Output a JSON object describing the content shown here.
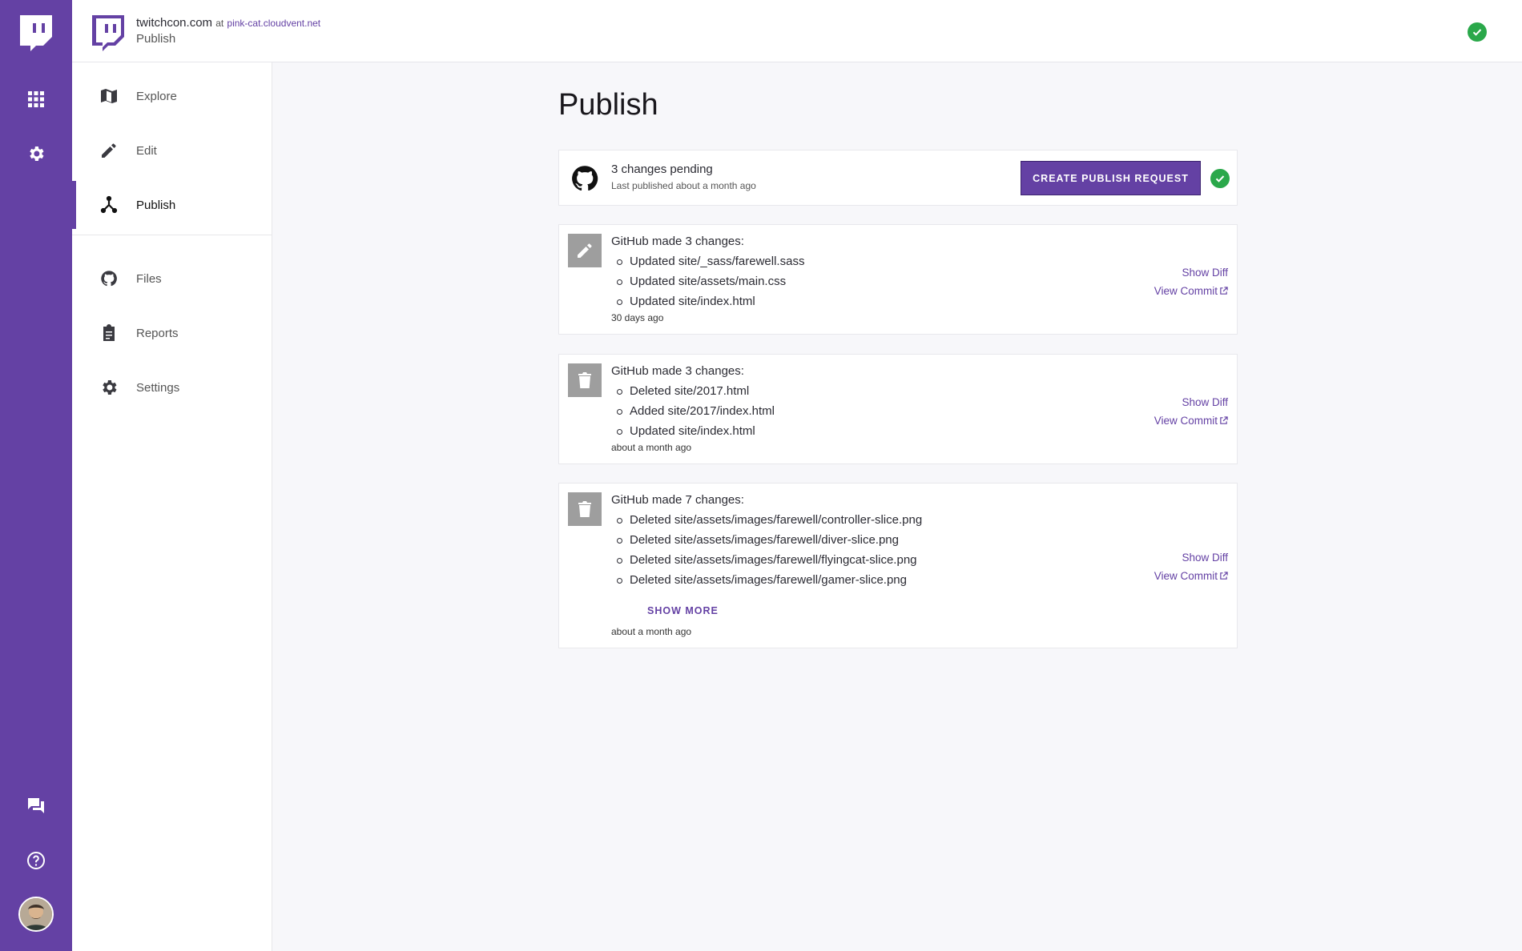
{
  "header": {
    "site_name": "twitchcon.com",
    "at_label": "at",
    "host": "pink-cat.cloudvent.net",
    "section": "Publish"
  },
  "rail": {
    "icons": [
      "apps-grid-icon",
      "gear-icon",
      "chat-icon",
      "help-icon"
    ]
  },
  "nav": {
    "items": [
      {
        "label": "Explore",
        "icon": "map-icon"
      },
      {
        "label": "Edit",
        "icon": "pencil-icon"
      },
      {
        "label": "Publish",
        "icon": "publish-icon",
        "active": true
      },
      {
        "label": "Files",
        "icon": "github-icon"
      },
      {
        "label": "Reports",
        "icon": "clipboard-icon"
      },
      {
        "label": "Settings",
        "icon": "gear-icon"
      }
    ]
  },
  "main": {
    "title": "Publish",
    "pending": {
      "summary": "3 changes pending",
      "last_published": "Last published about a month ago",
      "button_label": "CREATE PUBLISH REQUEST"
    },
    "changes": [
      {
        "icon": "pencil-icon",
        "heading": "GitHub made 3 changes:",
        "files": [
          "Updated site/_sass/farewell.sass",
          "Updated site/assets/main.css",
          "Updated site/index.html"
        ],
        "time": "30 days ago",
        "show_diff": "Show Diff",
        "view_commit": "View Commit"
      },
      {
        "icon": "trash-icon",
        "heading": "GitHub made 3 changes:",
        "files": [
          "Deleted site/2017.html",
          "Added site/2017/index.html",
          "Updated site/index.html"
        ],
        "time": "about a month ago",
        "show_diff": "Show Diff",
        "view_commit": "View Commit"
      },
      {
        "icon": "trash-icon",
        "heading": "GitHub made 7 changes:",
        "files": [
          "Deleted site/assets/images/farewell/controller-slice.png",
          "Deleted site/assets/images/farewell/diver-slice.png",
          "Deleted site/assets/images/farewell/flyingcat-slice.png",
          "Deleted site/assets/images/farewell/gamer-slice.png"
        ],
        "show_more": "SHOW MORE",
        "time": "about a month ago",
        "show_diff": "Show Diff",
        "view_commit": "View Commit"
      }
    ]
  },
  "colors": {
    "brand": "#6441a4",
    "success": "#2aa84a",
    "badge_gray": "#9e9e9e"
  }
}
